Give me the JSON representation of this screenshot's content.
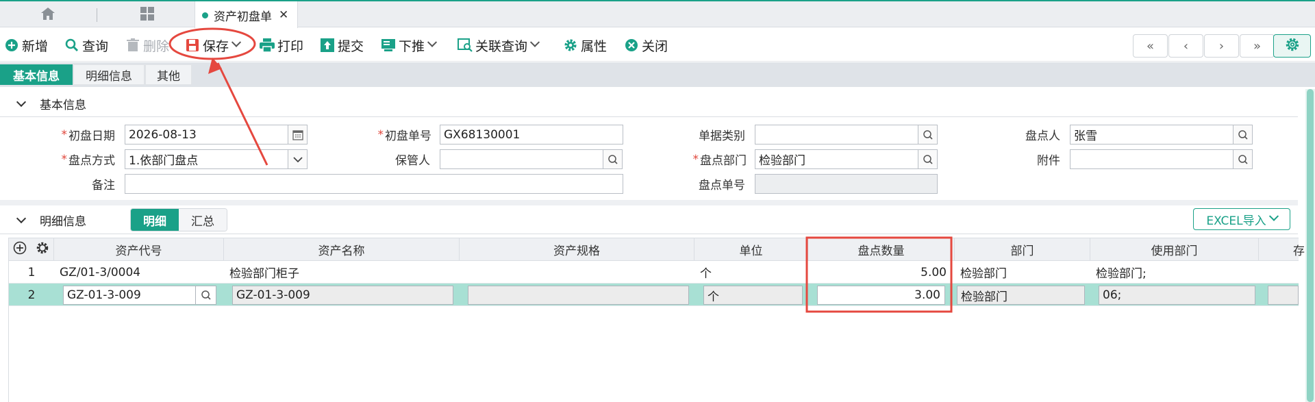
{
  "tabbar": {
    "home_icon": "home-icon",
    "apps_icon": "grid-apps-icon",
    "doc_tab_label": "资产初盘单",
    "close_glyph": "✕"
  },
  "toolbar": {
    "new_label": "新增",
    "query_label": "查询",
    "delete_label": "删除",
    "save_label": "保存",
    "print_label": "打印",
    "submit_label": "提交",
    "push_label": "下推",
    "linked_query_label": "关联查询",
    "properties_label": "属性",
    "close_label": "关闭",
    "nav": {
      "first": "«",
      "prev": "‹",
      "next": "›",
      "last": "»"
    }
  },
  "section_tabs": [
    "基本信息",
    "明细信息",
    "其他"
  ],
  "basic": {
    "title": "基本信息",
    "fields": {
      "init_date_label": "初盘日期",
      "init_date": "2026-08-13",
      "init_no_label": "初盘单号",
      "init_no": "GX68130001",
      "doc_type_label": "单据类别",
      "doc_type": "",
      "counter_label": "盘点人",
      "counter": "张雪",
      "method_label": "盘点方式",
      "method": "1.依部门盘点",
      "keeper_label": "保管人",
      "keeper": "",
      "dept_label": "盘点部门",
      "dept": "检验部门",
      "attach_label": "附件",
      "attach": "",
      "remark_label": "备注",
      "remark": "",
      "count_no_label": "盘点单号",
      "count_no": ""
    }
  },
  "detail": {
    "title": "明细信息",
    "tabs": [
      "明细",
      "汇总"
    ],
    "excel_label": "EXCEL导入",
    "columns": [
      "资产代号",
      "资产名称",
      "资产规格",
      "单位",
      "盘点数量",
      "部门",
      "使用部门",
      "存"
    ],
    "rows": [
      {
        "no": "1",
        "code": "GZ/01-3/0004",
        "name": "检验部门柜子",
        "spec": "",
        "unit": "个",
        "qty": "5.00",
        "dept": "检验部门",
        "use_dept": "检验部门;"
      },
      {
        "no": "2",
        "code": "GZ-01-3-009",
        "name": "GZ-01-3-009",
        "spec": "",
        "unit": "个",
        "qty": "3.00",
        "dept": "检验部门",
        "use_dept": "06;"
      }
    ]
  },
  "colors": {
    "accent": "#1aa188",
    "annotation": "#e5483f",
    "selected_row": "#a8e0d4"
  }
}
